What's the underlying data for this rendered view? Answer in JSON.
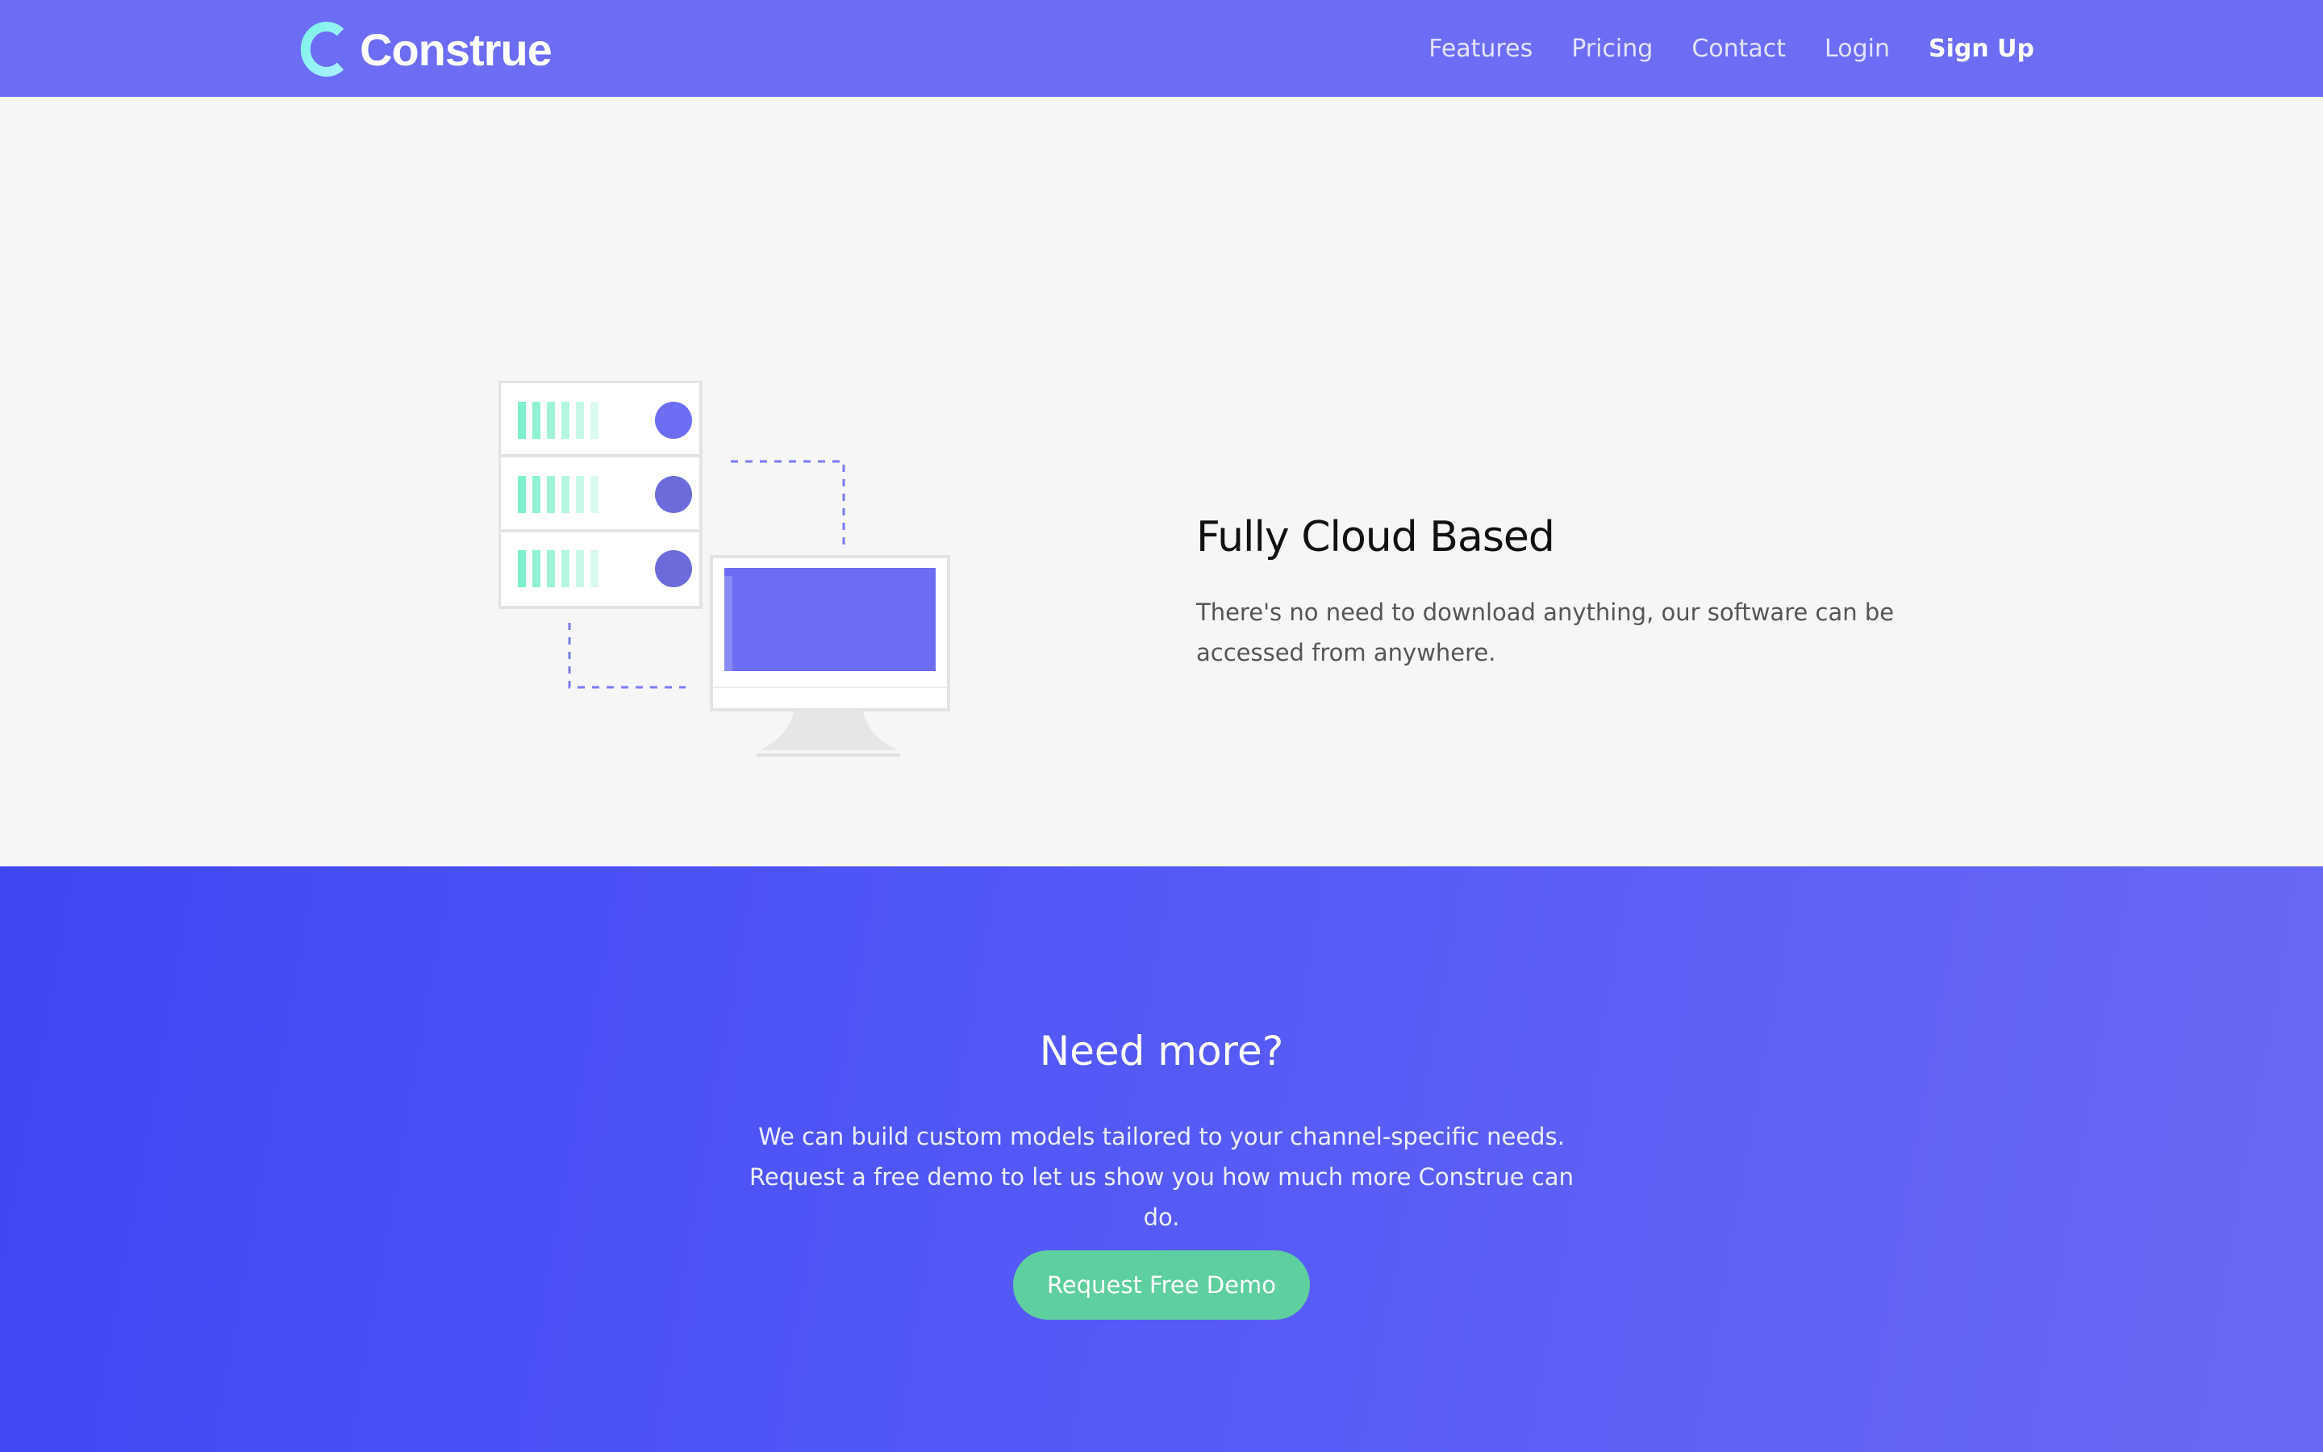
{
  "brand": {
    "name": "Construe",
    "mark_letter": "C",
    "mark_icon": "c-logo-icon"
  },
  "nav": {
    "links": [
      {
        "label": "Features"
      },
      {
        "label": "Pricing"
      },
      {
        "label": "Contact"
      },
      {
        "label": "Login"
      },
      {
        "label": "Sign Up"
      }
    ]
  },
  "feature": {
    "title": "Fully Cloud Based",
    "description": "There's no need to download anything, our software can be accessed from anywhere.",
    "illustration_icon": "server-to-monitor-illustration"
  },
  "cta": {
    "title": "Need more?",
    "description": "We can build custom models tailored to your channel-specific needs. Request a free demo to let us show you how much more Construe can do.",
    "button_label": "Request Free Demo"
  },
  "colors": {
    "nav_bg": "#6c6cf5",
    "accent_purple": "#6c6cf5",
    "accent_mint": "#5ecf9f",
    "page_bg": "#f6f6f6",
    "cta_gradient_start": "#4146f5",
    "cta_gradient_end": "#6b68f5"
  }
}
